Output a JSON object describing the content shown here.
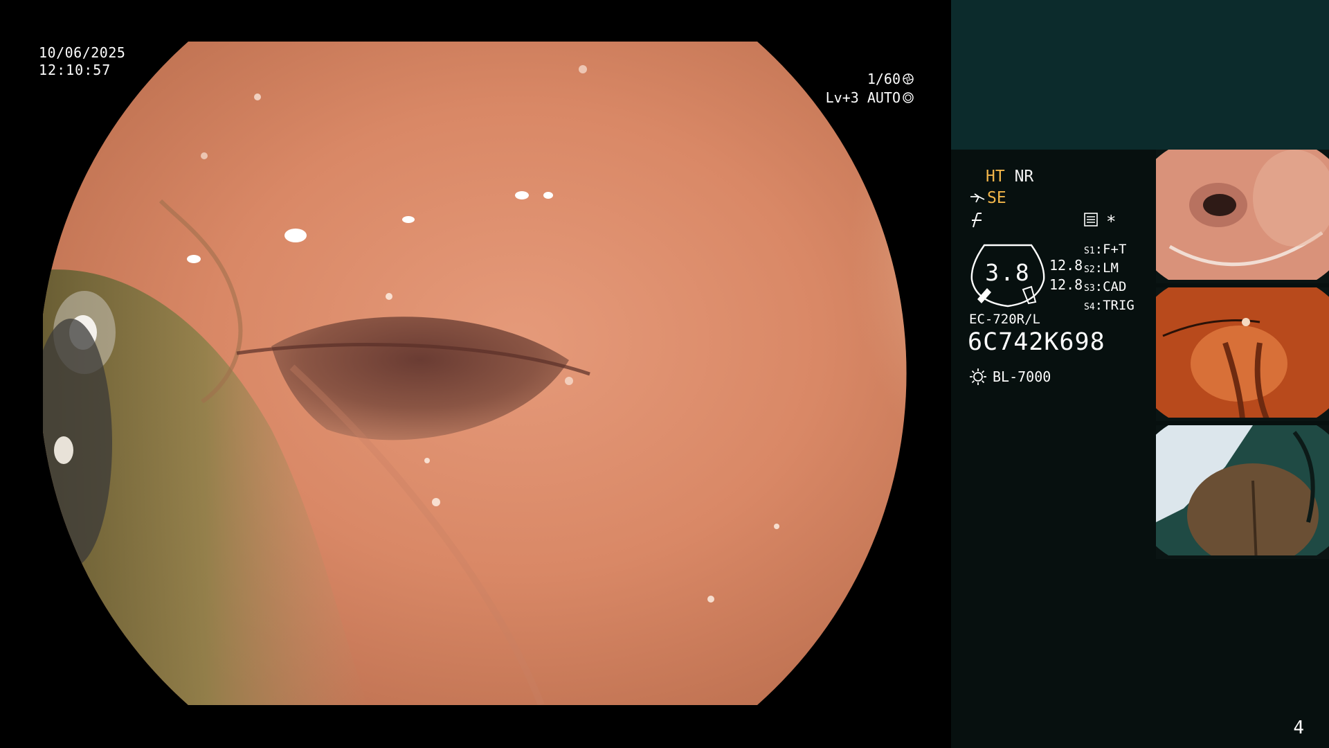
{
  "overlay": {
    "date": "10/06/2025",
    "time": "12:10:57",
    "shutter_speed": "1/60",
    "iris_mode": "Lv+3 AUTO"
  },
  "info_panel": {
    "ht_label": "HT",
    "nr_label": "NR",
    "se_label": "SE",
    "gauge_value": "3.8",
    "gauge_side_top": "12.8",
    "gauge_side_bottom": "12.8",
    "switches": [
      {
        "key": "S1",
        "value": "F+T"
      },
      {
        "key": "S2",
        "value": "LM"
      },
      {
        "key": "S3",
        "value": "CAD"
      },
      {
        "key": "S4",
        "value": "TRIG"
      }
    ],
    "scope_model": "EC-720R/L",
    "scope_serial": "6C742K698",
    "light_source": "BL-7000",
    "star_mark": "*"
  },
  "page_number": "4",
  "colors": {
    "panel_bg": "#07100f",
    "panel_header": "#0c2b2c",
    "accent_orange": "#f2b64a",
    "text": "#f2f2f2"
  },
  "icons": [
    "camera-shutter-icon",
    "iris-icon",
    "scope-tip-icon",
    "freeze-icon",
    "memory-card-icon",
    "light-source-icon"
  ]
}
